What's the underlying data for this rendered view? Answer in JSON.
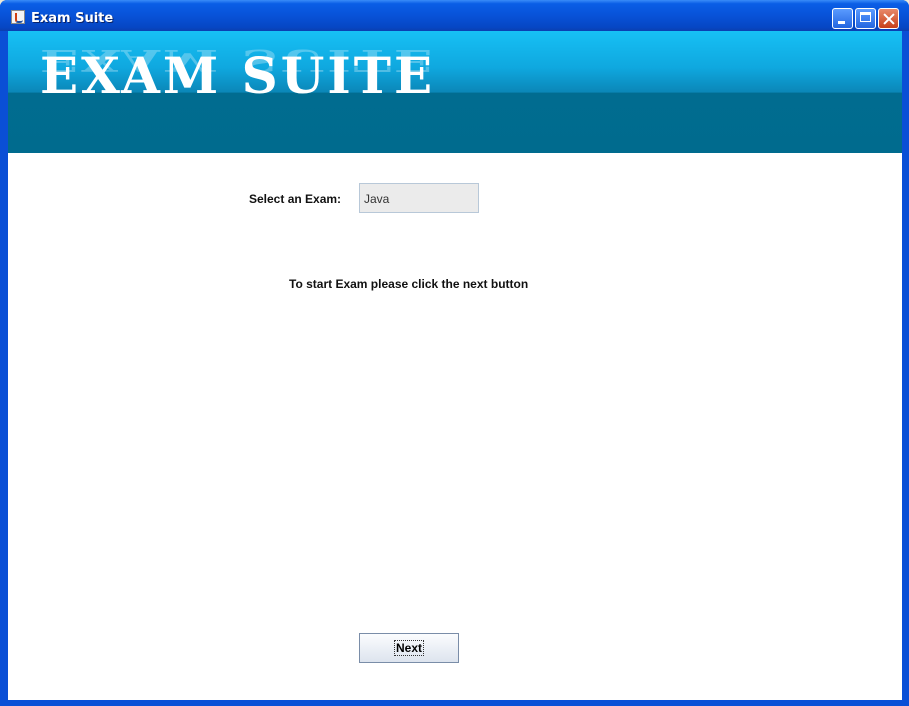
{
  "window": {
    "title": "Exam Suite"
  },
  "banner": {
    "title": "EXAM SUITE"
  },
  "form": {
    "select_label": "Select an Exam:",
    "selected_exam": "Java",
    "instruction": "To start Exam please click the next button",
    "next_label": "Next"
  },
  "colors": {
    "banner_top": "#17c0f5",
    "banner_bottom": "#006b8e",
    "titlebar": "#0852d8"
  }
}
